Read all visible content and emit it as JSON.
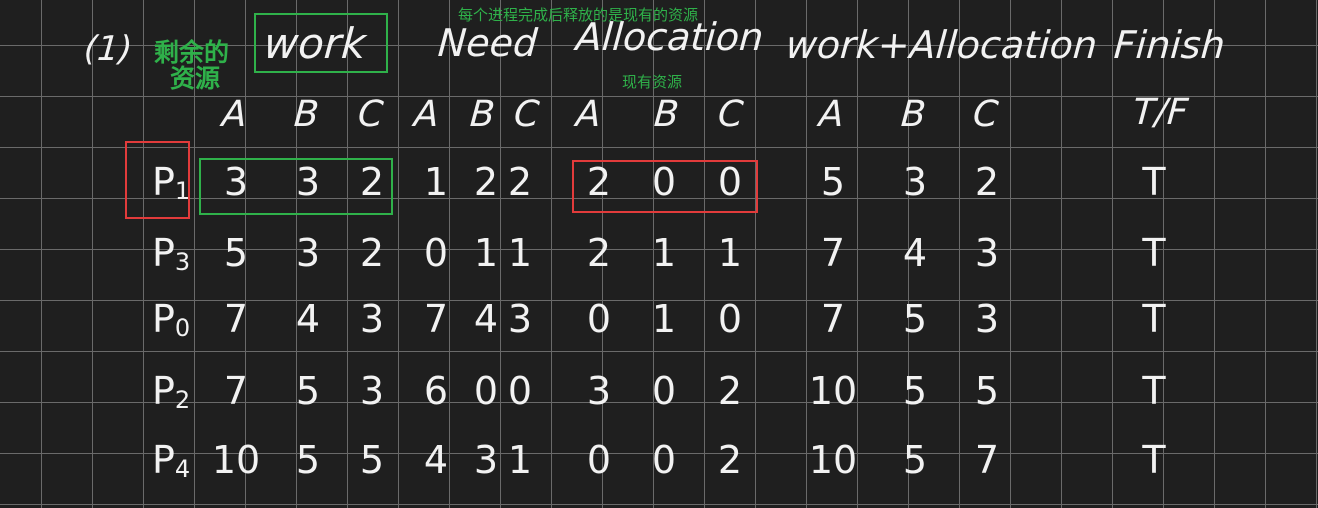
{
  "part_label": "(1)",
  "notes": {
    "top_center": "每个进程完成后释放的是现有的资源",
    "remaining_resources": "剩余的",
    "remaining_resources_line2": "资源",
    "current_resources": "现有资源"
  },
  "headers": {
    "work": "work",
    "need": "Need",
    "allocation": "Allocation",
    "work_plus_allocation": "work+Allocation",
    "finish": "Finish",
    "finish_sub": "T/F"
  },
  "subheaders": [
    "A",
    "B",
    "C",
    "A",
    "B",
    "C",
    "A",
    "B",
    "C",
    "A",
    "B",
    "C"
  ],
  "rows": [
    {
      "proc": "P",
      "sub": "1",
      "work": [
        "3",
        "3",
        "2"
      ],
      "need": [
        "1",
        "2",
        "2"
      ],
      "alloc": [
        "2",
        "0",
        "0"
      ],
      "wa": [
        "5",
        "3",
        "2"
      ],
      "finish": "T"
    },
    {
      "proc": "P",
      "sub": "3",
      "work": [
        "5",
        "3",
        "2"
      ],
      "need": [
        "0",
        "1",
        "1"
      ],
      "alloc": [
        "2",
        "1",
        "1"
      ],
      "wa": [
        "7",
        "4",
        "3"
      ],
      "finish": "T"
    },
    {
      "proc": "P",
      "sub": "0",
      "work": [
        "7",
        "4",
        "3"
      ],
      "need": [
        "7",
        "4",
        "3"
      ],
      "alloc": [
        "0",
        "1",
        "0"
      ],
      "wa": [
        "7",
        "5",
        "3"
      ],
      "finish": "T"
    },
    {
      "proc": "P",
      "sub": "2",
      "work": [
        "7",
        "5",
        "3"
      ],
      "need": [
        "6",
        "0",
        "0"
      ],
      "alloc": [
        "3",
        "0",
        "2"
      ],
      "wa": [
        "10",
        "5",
        "5"
      ],
      "finish": "T"
    },
    {
      "proc": "P",
      "sub": "4",
      "work": [
        "10",
        "5",
        "5"
      ],
      "need": [
        "4",
        "3",
        "1"
      ],
      "alloc": [
        "0",
        "0",
        "2"
      ],
      "wa": [
        "10",
        "5",
        "7"
      ],
      "finish": "T"
    }
  ],
  "colors": {
    "background": "#1f1f1f",
    "grid": "#6a6a6a",
    "annotation_green": "#2fb14a",
    "annotation_red": "#e23b3b",
    "ink": "#f2f2f2"
  }
}
